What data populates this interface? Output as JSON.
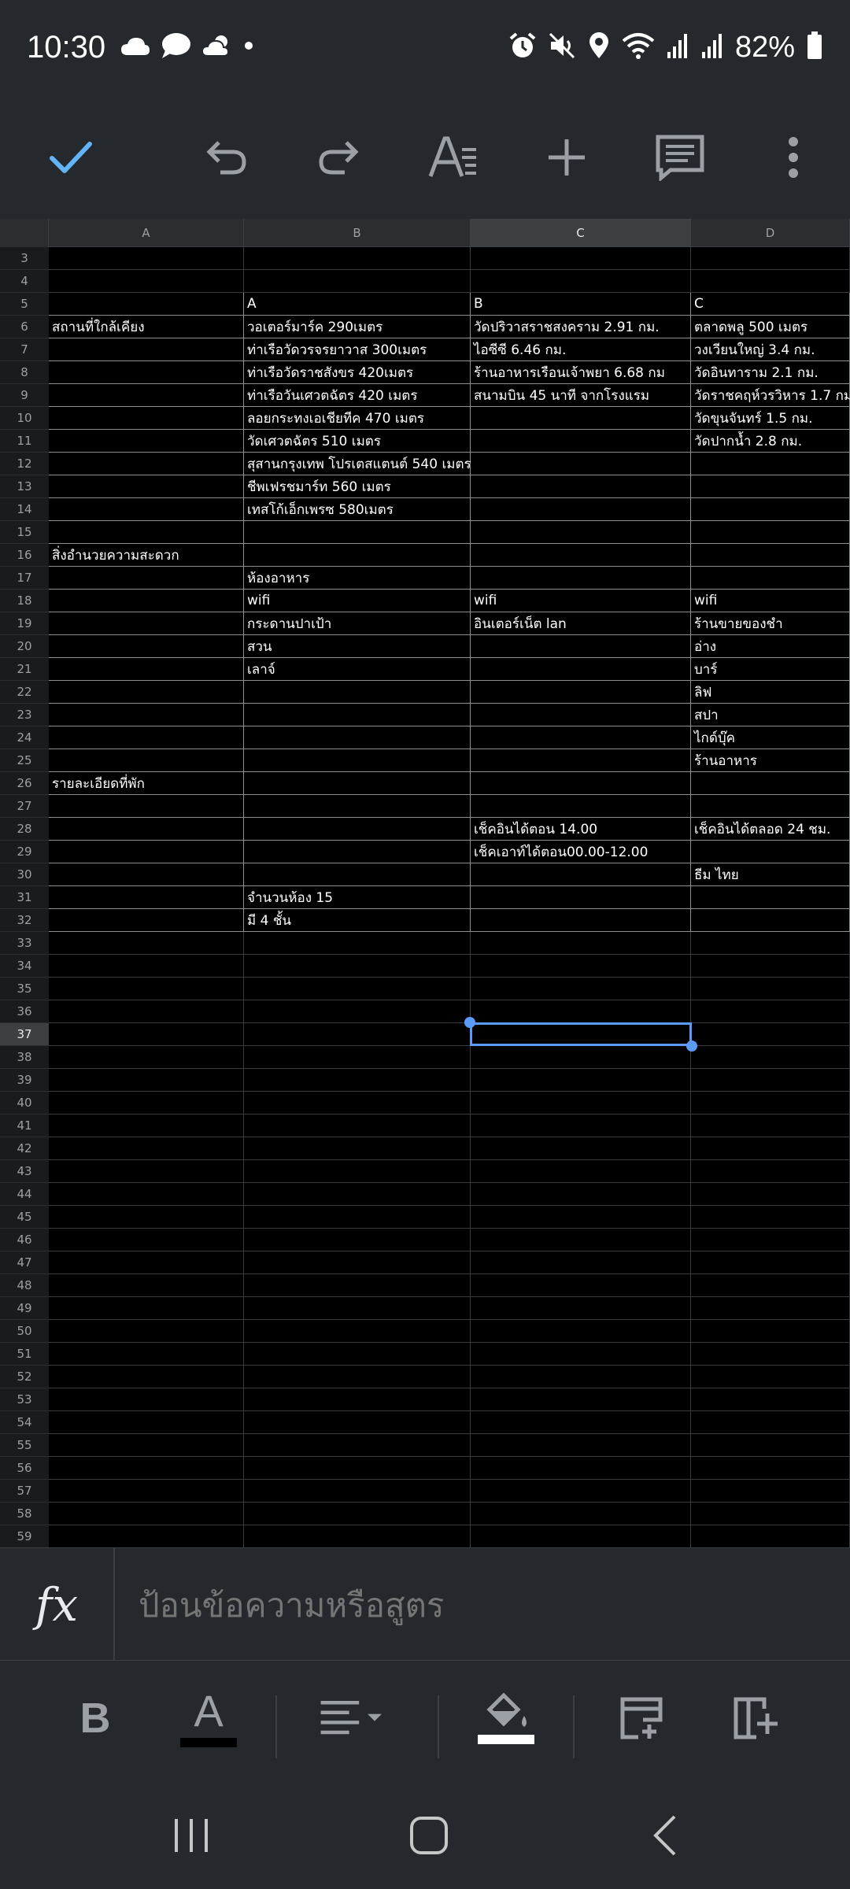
{
  "status_bar": {
    "time": "10:30",
    "battery": "82%",
    "left_icons": [
      "cloud-icon",
      "chat-bubble-icon",
      "cloud-sun-icon",
      "dot-icon"
    ],
    "right_icons": [
      "alarm-icon",
      "mute-icon",
      "location-icon",
      "wifi-icon",
      "signal-icon",
      "signal-icon",
      "battery-icon"
    ]
  },
  "toolbar": {
    "buttons": [
      "check-icon",
      "undo-icon",
      "redo-icon",
      "text-format-icon",
      "add-icon",
      "comment-icon",
      "more-vert-icon"
    ]
  },
  "columns": [
    {
      "id": "A",
      "header": "A"
    },
    {
      "id": "B",
      "header": "B"
    },
    {
      "id": "C",
      "header": "C",
      "selected": true
    },
    {
      "id": "D",
      "header": "D"
    }
  ],
  "rows": [
    {
      "num": "3",
      "cells": [
        "",
        "",
        "",
        ""
      ]
    },
    {
      "num": "4",
      "cells": [
        "",
        "",
        "",
        ""
      ]
    },
    {
      "num": "5",
      "cells": [
        "",
        "A",
        "B",
        "C"
      ]
    },
    {
      "num": "6",
      "cells": [
        "สถานที่ใกล้เคียง",
        "วอเตอร์มาร์ค 290เมตร",
        "วัดปริวาสราชสงคราม 2.91 กม.",
        "ตลาดพลู 500 เมตร"
      ]
    },
    {
      "num": "7",
      "cells": [
        "",
        "ท่าเรือวัดวรจรยาวาส 300เมตร",
        "ไอซีซี 6.46 กม.",
        "วงเวียนใหญ่ 3.4 กม."
      ]
    },
    {
      "num": "8",
      "cells": [
        "",
        "ท่าเรือวัดราชสังขร 420เมตร",
        "ร้านอาหารเรือนเจ้าพยา 6.68 กม",
        "วัดอินทาราม 2.1 กม."
      ]
    },
    {
      "num": "9",
      "cells": [
        "",
        "ท่าเรือวันเศวตฉัตร 420 เมตร",
        "สนามบิน 45 นาที จากโรงแรม",
        "วัดราชคฤห์วรวิหาร 1.7 กม"
      ]
    },
    {
      "num": "10",
      "cells": [
        "",
        "ลอยกระทงเอเชียทีค 470 เมตร",
        "",
        "วัดขุนจันทร์ 1.5 กม."
      ]
    },
    {
      "num": "11",
      "cells": [
        "",
        "วัดเศวตฉัตร 510 เมตร",
        "",
        "วัดปากน้ำ 2.8 กม."
      ]
    },
    {
      "num": "12",
      "cells": [
        "",
        "สุสานกรุงเทพ โปรเตสแตนต์ 540 เมตร",
        "",
        ""
      ]
    },
    {
      "num": "13",
      "cells": [
        "",
        "ชีพเฟรชมาร์ท 560 เมตร",
        "",
        ""
      ]
    },
    {
      "num": "14",
      "cells": [
        "",
        "เทสโก้เอ็กเพรซ 580เมตร",
        "",
        ""
      ]
    },
    {
      "num": "15",
      "cells": [
        "",
        "",
        "",
        ""
      ]
    },
    {
      "num": "16",
      "cells": [
        "สิ่งอำนวยความสะดวก",
        "",
        "",
        ""
      ]
    },
    {
      "num": "17",
      "cells": [
        "",
        "ห้องอาหาร",
        "",
        ""
      ]
    },
    {
      "num": "18",
      "cells": [
        "",
        "wifi",
        "wifi",
        "wifi"
      ]
    },
    {
      "num": "19",
      "cells": [
        "",
        "กระดานปาเป้า",
        "อินเตอร์เน็ต lan",
        "ร้านขายของชำ"
      ]
    },
    {
      "num": "20",
      "cells": [
        "",
        "สวน",
        "",
        "อ่าง"
      ]
    },
    {
      "num": "21",
      "cells": [
        "",
        "เลาจ์",
        "",
        "บาร์"
      ]
    },
    {
      "num": "22",
      "cells": [
        "",
        "",
        "",
        "ลิฟ"
      ]
    },
    {
      "num": "23",
      "cells": [
        "",
        "",
        "",
        "สปา"
      ]
    },
    {
      "num": "24",
      "cells": [
        "",
        "",
        "",
        "ไกด์บุ๊ค"
      ]
    },
    {
      "num": "25",
      "cells": [
        "",
        "",
        "",
        "ร้านอาหาร"
      ]
    },
    {
      "num": "26",
      "cells": [
        "รายละเอียดที่พัก",
        "",
        "",
        ""
      ]
    },
    {
      "num": "27",
      "cells": [
        "",
        "",
        "",
        ""
      ]
    },
    {
      "num": "28",
      "cells": [
        "",
        "",
        "เช็คอินได้ตอน 14.00",
        "เช็คอินได้ตลอด 24 ชม."
      ]
    },
    {
      "num": "29",
      "cells": [
        "",
        "",
        "เช็คเอาท์ได้ตอน00.00-12.00",
        ""
      ]
    },
    {
      "num": "30",
      "cells": [
        "",
        "",
        "",
        "ธีม ไทย"
      ]
    },
    {
      "num": "31",
      "cells": [
        "",
        "จำนวนห้อง 15",
        "",
        ""
      ]
    },
    {
      "num": "32",
      "cells": [
        "",
        "มี 4 ชั้น",
        "",
        ""
      ]
    },
    {
      "num": "33",
      "cells": [
        "",
        "",
        "",
        ""
      ]
    },
    {
      "num": "34",
      "cells": [
        "",
        "",
        "",
        ""
      ]
    },
    {
      "num": "35",
      "cells": [
        "",
        "",
        "",
        ""
      ]
    },
    {
      "num": "36",
      "cells": [
        "",
        "",
        "",
        ""
      ]
    },
    {
      "num": "37",
      "cells": [
        "",
        "",
        "",
        ""
      ],
      "selected": true
    },
    {
      "num": "38",
      "cells": [
        "",
        "",
        "",
        ""
      ]
    },
    {
      "num": "39",
      "cells": [
        "",
        "",
        "",
        ""
      ]
    },
    {
      "num": "40",
      "cells": [
        "",
        "",
        "",
        ""
      ]
    },
    {
      "num": "41",
      "cells": [
        "",
        "",
        "",
        ""
      ]
    },
    {
      "num": "42",
      "cells": [
        "",
        "",
        "",
        ""
      ]
    },
    {
      "num": "43",
      "cells": [
        "",
        "",
        "",
        ""
      ]
    },
    {
      "num": "44",
      "cells": [
        "",
        "",
        "",
        ""
      ]
    },
    {
      "num": "45",
      "cells": [
        "",
        "",
        "",
        ""
      ]
    },
    {
      "num": "46",
      "cells": [
        "",
        "",
        "",
        ""
      ]
    },
    {
      "num": "47",
      "cells": [
        "",
        "",
        "",
        ""
      ]
    },
    {
      "num": "48",
      "cells": [
        "",
        "",
        "",
        ""
      ]
    },
    {
      "num": "49",
      "cells": [
        "",
        "",
        "",
        ""
      ]
    },
    {
      "num": "50",
      "cells": [
        "",
        "",
        "",
        ""
      ]
    },
    {
      "num": "51",
      "cells": [
        "",
        "",
        "",
        ""
      ]
    },
    {
      "num": "52",
      "cells": [
        "",
        "",
        "",
        ""
      ]
    },
    {
      "num": "53",
      "cells": [
        "",
        "",
        "",
        ""
      ]
    },
    {
      "num": "54",
      "cells": [
        "",
        "",
        "",
        ""
      ]
    },
    {
      "num": "55",
      "cells": [
        "",
        "",
        "",
        ""
      ]
    },
    {
      "num": "56",
      "cells": [
        "",
        "",
        "",
        ""
      ]
    },
    {
      "num": "57",
      "cells": [
        "",
        "",
        "",
        ""
      ]
    },
    {
      "num": "58",
      "cells": [
        "",
        "",
        "",
        ""
      ]
    },
    {
      "num": "59",
      "cells": [
        "",
        "",
        "",
        ""
      ]
    }
  ],
  "selected_cell": "C37",
  "formula_bar": {
    "fx_label": "fx",
    "placeholder": "ป้อนข้อความหรือสูตร"
  },
  "format_bar": {
    "bold_label": "B",
    "text_color_label": "A",
    "buttons": [
      "bold-icon",
      "text-color-icon",
      "align-icon",
      "fill-color-icon",
      "insert-row-icon",
      "insert-column-icon"
    ]
  },
  "nav_bar": {
    "buttons": [
      "recents-icon",
      "home-icon",
      "back-icon"
    ]
  },
  "colors": {
    "chrome": "#25292e",
    "accent": "#5b9bf7",
    "grid_bg": "#000000"
  }
}
